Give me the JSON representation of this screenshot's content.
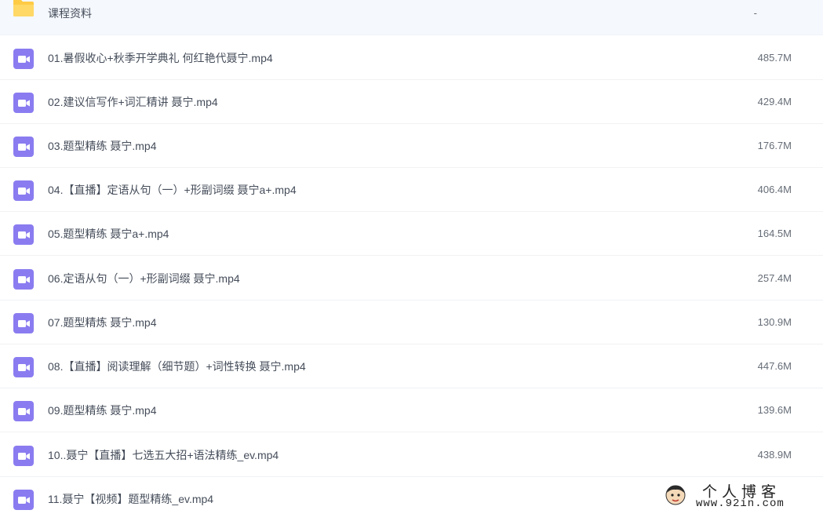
{
  "folder": {
    "name": "课程资料",
    "size": "-"
  },
  "files": [
    {
      "name": "01.暑假收心+秋季开学典礼 何红艳代聂宁.mp4",
      "size": "485.7M"
    },
    {
      "name": "02.建议信写作+词汇精讲 聂宁.mp4",
      "size": "429.4M"
    },
    {
      "name": "03.题型精练 聂宁.mp4",
      "size": "176.7M"
    },
    {
      "name": "04.【直播】定语从句（一）+形副词缀 聂宁a+.mp4",
      "size": "406.4M"
    },
    {
      "name": "05.题型精练 聂宁a+.mp4",
      "size": "164.5M"
    },
    {
      "name": "06.定语从句（一）+形副词缀 聂宁.mp4",
      "size": "257.4M"
    },
    {
      "name": "07.题型精炼 聂宁.mp4",
      "size": "130.9M"
    },
    {
      "name": "08.【直播】阅读理解（细节题）+词性转换 聂宁.mp4",
      "size": "447.6M"
    },
    {
      "name": "09.题型精练 聂宁.mp4",
      "size": "139.6M"
    },
    {
      "name": "10..聂宁【直播】七选五大招+语法精练_ev.mp4",
      "size": "438.9M"
    },
    {
      "name": "11.聂宁【视频】题型精练_ev.mp4",
      "size": ""
    }
  ],
  "watermark": {
    "title": "个人博客",
    "url": "www.92in.com"
  },
  "colors": {
    "video_icon": "#8a7cf0",
    "folder_icon": "#ffcb45",
    "text": "#454d5a"
  }
}
